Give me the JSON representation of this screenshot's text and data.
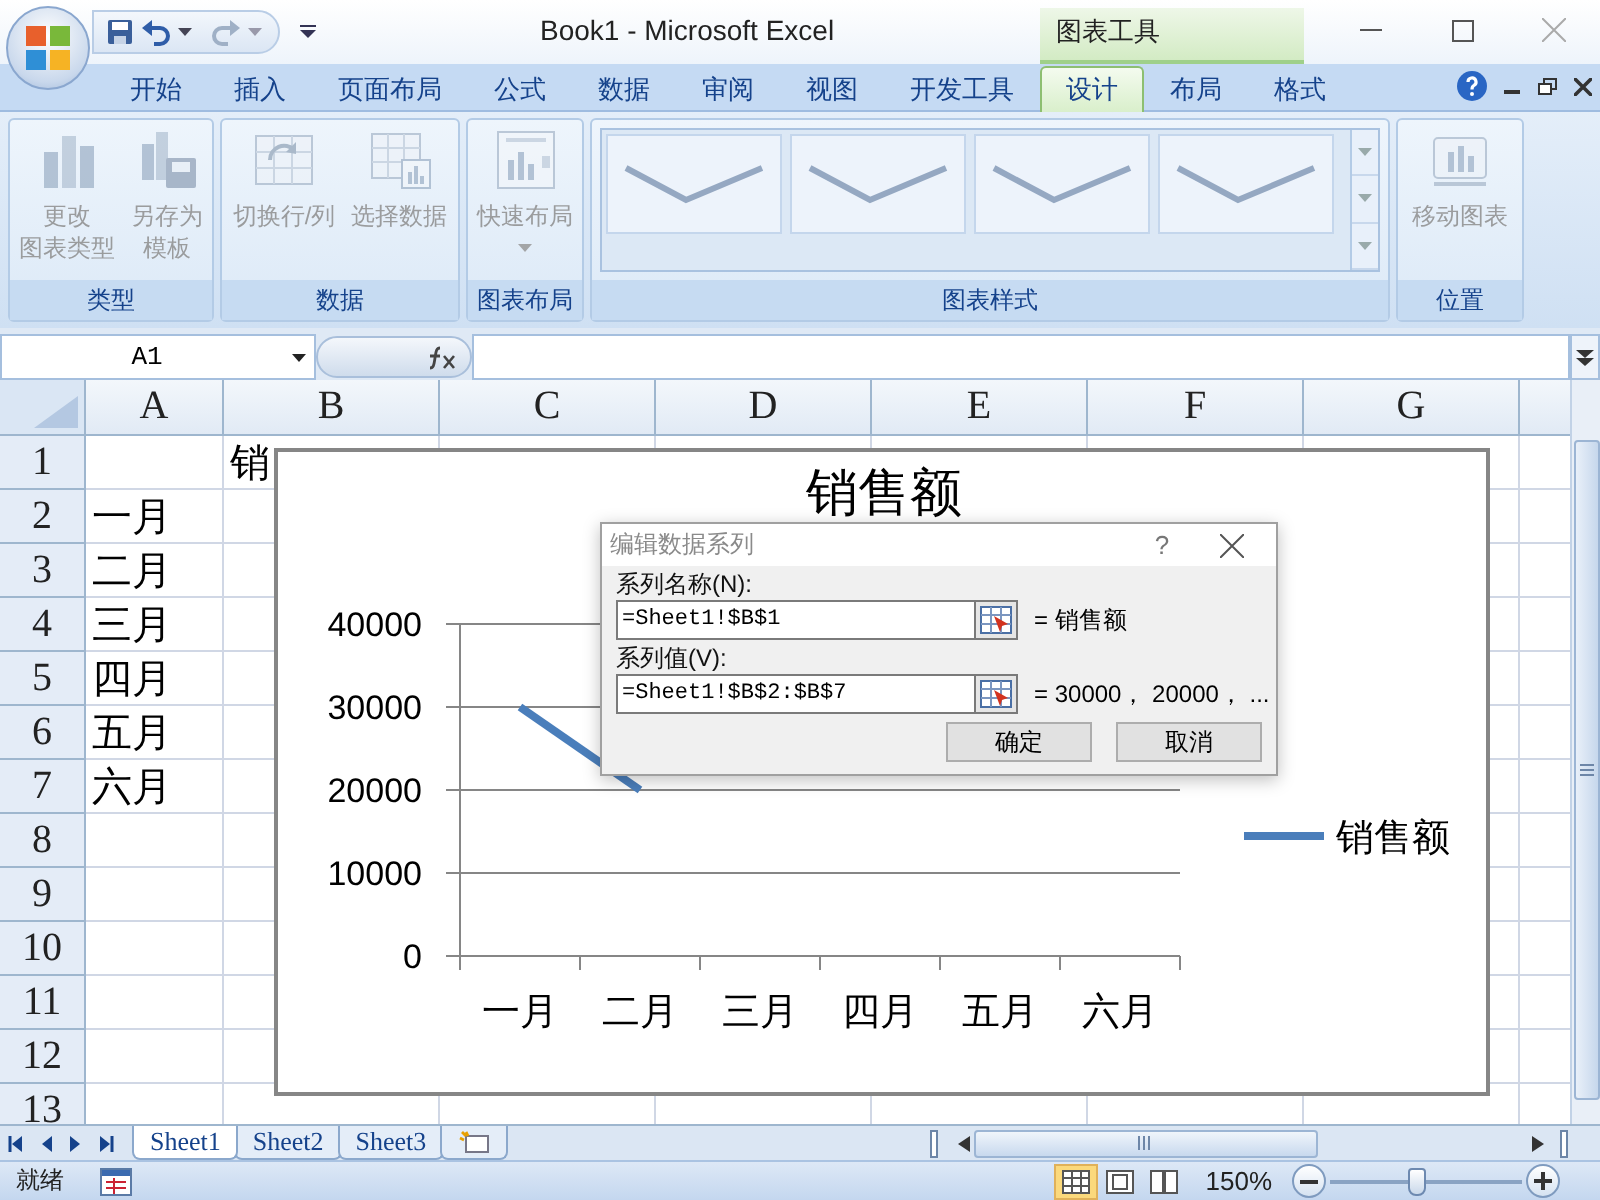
{
  "title_bar": {
    "title": "Book1 - Microsoft Excel",
    "context_tab": "图表工具"
  },
  "ribbon_tabs": [
    {
      "label": "开始",
      "selected": false
    },
    {
      "label": "插入",
      "selected": false
    },
    {
      "label": "页面布局",
      "selected": false
    },
    {
      "label": "公式",
      "selected": false
    },
    {
      "label": "数据",
      "selected": false
    },
    {
      "label": "审阅",
      "selected": false
    },
    {
      "label": "视图",
      "selected": false
    },
    {
      "label": "开发工具",
      "selected": false
    },
    {
      "label": "设计",
      "selected": true
    },
    {
      "label": "布局",
      "selected": false
    },
    {
      "label": "格式",
      "selected": false
    }
  ],
  "ribbon_groups": [
    {
      "label": "类型",
      "kind": "buttons",
      "buttons": [
        {
          "lines": [
            "更改",
            "图表类型"
          ],
          "disabled": true,
          "dropdown": false
        },
        {
          "lines": [
            "另存为",
            "模板"
          ],
          "disabled": true,
          "dropdown": false
        }
      ]
    },
    {
      "label": "数据",
      "kind": "buttons",
      "buttons": [
        {
          "lines": [
            "切换行/列"
          ],
          "disabled": true,
          "dropdown": false
        },
        {
          "lines": [
            "选择数据"
          ],
          "disabled": true,
          "dropdown": false
        }
      ]
    },
    {
      "label": "图表布局",
      "kind": "buttons",
      "buttons": [
        {
          "lines": [
            "快速布局"
          ],
          "disabled": true,
          "dropdown": true
        }
      ]
    },
    {
      "label": "图表样式",
      "kind": "gallery",
      "styles": [
        {
          "kind": "line"
        },
        {
          "kind": "line"
        },
        {
          "kind": "line"
        },
        {
          "kind": "line"
        }
      ]
    },
    {
      "label": "位置",
      "kind": "buttons",
      "buttons": [
        {
          "lines": [
            "移动图表"
          ],
          "disabled": true,
          "dropdown": false
        }
      ]
    }
  ],
  "formula_bar": {
    "name_box": "A1"
  },
  "sheet": {
    "columns": [
      "A",
      "B",
      "C",
      "D",
      "E",
      "F",
      "G"
    ],
    "rows": [
      {
        "header": "1",
        "b": "销"
      },
      {
        "header": "2",
        "a": "一月"
      },
      {
        "header": "3",
        "a": "二月"
      },
      {
        "header": "4",
        "a": "三月"
      },
      {
        "header": "5",
        "a": "四月"
      },
      {
        "header": "6",
        "a": "五月"
      },
      {
        "header": "7",
        "a": "六月"
      },
      {
        "header": "8"
      },
      {
        "header": "9"
      },
      {
        "header": "10"
      },
      {
        "header": "11"
      },
      {
        "header": "12"
      },
      {
        "header": "13"
      }
    ]
  },
  "chart": {
    "chart_data": {
      "type": "line",
      "title": "销售额",
      "grid": true,
      "categories": [
        "一月",
        "二月",
        "三月",
        "四月",
        "五月",
        "六月"
      ],
      "ylim": [
        0,
        40000
      ],
      "yticks": [
        0,
        10000,
        20000,
        30000,
        40000
      ],
      "series": [
        {
          "name": "销售额",
          "color": "#4a7ebb",
          "values": [
            30000,
            20000,
            null,
            null,
            null,
            null
          ]
        }
      ]
    }
  },
  "dialog": {
    "title": "编辑数据系列",
    "help": "?",
    "fields": [
      {
        "label": "系列名称(N):",
        "value": "=Sheet1!$B$1",
        "preview": "= 销售额"
      },
      {
        "label": "系列值(V):",
        "value": "=Sheet1!$B$2:$B$7",
        "preview": "= 30000， 20000， ..."
      }
    ],
    "buttons": [
      "确定",
      "取消"
    ]
  },
  "sheet_tabs": [
    {
      "label": "Sheet1",
      "selected": true
    },
    {
      "label": "Sheet2",
      "selected": false
    },
    {
      "label": "Sheet3",
      "selected": false
    }
  ],
  "status_bar": {
    "status": "就绪",
    "views": [
      {
        "selected": true
      },
      {
        "selected": false
      },
      {
        "selected": false
      }
    ],
    "zoom": "150%",
    "zoom_slider": {
      "level": 0.45
    }
  }
}
